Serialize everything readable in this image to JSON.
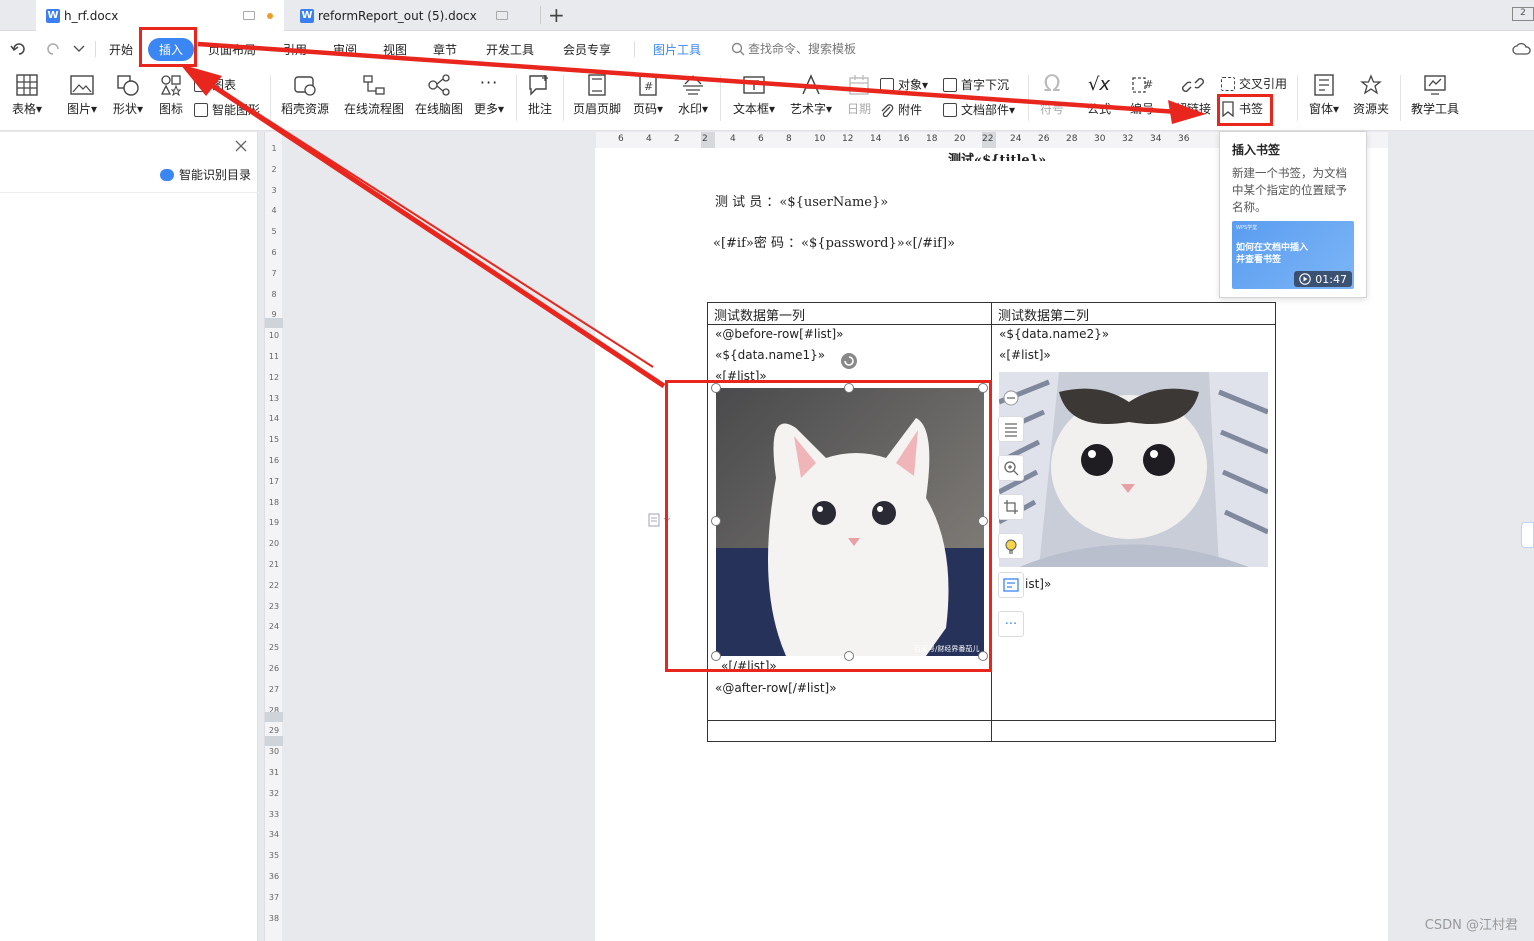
{
  "tabs": [
    {
      "label": "h_rf.docx"
    },
    {
      "label": "reformReport_out (5).docx"
    }
  ],
  "new_tab": "+",
  "menu": {
    "items": [
      "开始",
      "插入",
      "页面布局",
      "引用",
      "审阅",
      "视图",
      "章节",
      "开发工具",
      "会员专享"
    ],
    "picture_tools": "图片工具",
    "search": "查找命令、搜索模板"
  },
  "ribbon": {
    "table": "表格",
    "picture": "图片",
    "shape": "形状",
    "icon": "图标",
    "chart": "图表",
    "smart_graphic": "智能图形",
    "docer_resources": "稻壳资源",
    "flowchart": "在线流程图",
    "mindmap": "在线脑图",
    "more": "更多",
    "comment": "批注",
    "header_footer": "页眉页脚",
    "page_number": "页码",
    "watermark": "水印",
    "textbox": "文本框",
    "wordart": "艺术字",
    "date": "日期",
    "object": "对象",
    "attachment": "附件",
    "dropcap": "首字下沉",
    "doc_parts": "文档部件",
    "symbol": "符号",
    "formula": "公式",
    "numbering": "编号",
    "hyperlink": "超链接",
    "cross_ref": "交叉引用",
    "bookmark": "书签",
    "window": "窗体",
    "resources": "资源夹",
    "teaching": "教学工具"
  },
  "left_panel": {
    "smart_toc": "智能识别目录"
  },
  "vruler_nums": [
    "1",
    "2",
    "3",
    "4",
    "5",
    "6",
    "7",
    "8",
    "9",
    "10",
    "11",
    "12",
    "13",
    "14",
    "15",
    "16",
    "17",
    "18",
    "19",
    "20",
    "21",
    "22",
    "23",
    "24",
    "25",
    "26",
    "27",
    "28",
    "29",
    "30",
    "31",
    "32",
    "33",
    "34",
    "35",
    "36",
    "37",
    "38"
  ],
  "hruler_nums": [
    "6",
    "4",
    "2",
    "2",
    "4",
    "6",
    "8",
    "10",
    "12",
    "14",
    "16",
    "18",
    "20",
    "22",
    "24",
    "26",
    "28",
    "30",
    "32",
    "34",
    "36"
  ],
  "document": {
    "title_partial": "测试«${title}»",
    "tester_line": "测 试 员 ：«${userName}»",
    "password_line": "«[#if»密 码 ：«${password}»«[/#if]»",
    "table": {
      "headers": [
        "测试数据第一列",
        "测试数据第二列"
      ],
      "col1_lines": [
        "«@before-row[#list]»",
        "«${data.name1}»",
        "«[#list]»",
        "«[/#list]»",
        "«@after-row[/#list]»"
      ],
      "col2_lines": [
        "«${data.name2}»",
        "«[#list]»",
        "ist]»"
      ]
    },
    "image_caption": "百家号/财经界番茄儿"
  },
  "tooltip": {
    "title": "插入书签",
    "body": "新建一个书签，为文档中某个指定的位置赋予名称。",
    "video_tag": "WPS学堂",
    "video_title": "如何在文档中插入并查看书签",
    "duration": "01:47"
  },
  "watermark": "CSDN @江村君",
  "colors": {
    "accent": "#3a86f3",
    "annotation_red": "#e8261d",
    "modified_dot": "#f29b2b"
  }
}
